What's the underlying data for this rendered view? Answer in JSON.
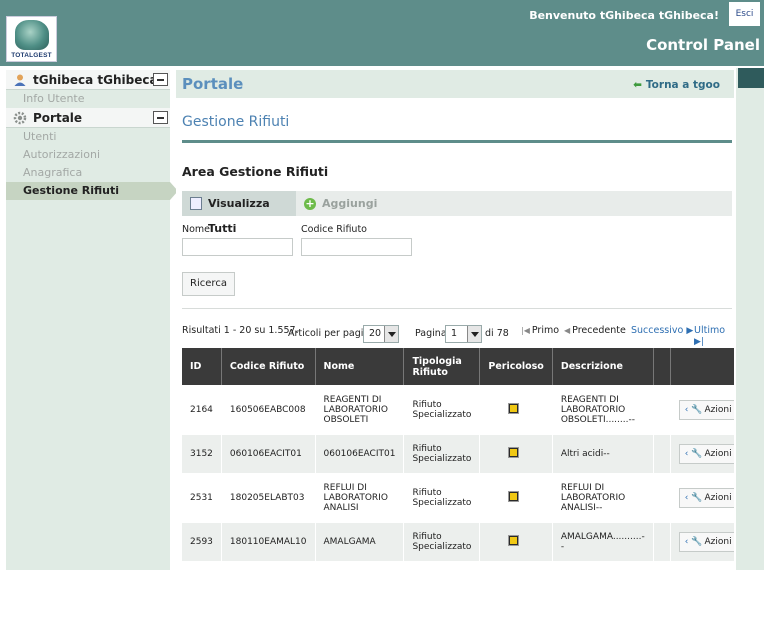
{
  "header": {
    "logo_text": "TOTALGEST",
    "welcome": "Benvenuto tGhibeca tGhibeca!",
    "logout": "Esci",
    "panel_title": "Control Panel"
  },
  "sidebar": {
    "user_section": {
      "title": "tGhibeca tGhibeca",
      "items": [
        {
          "label": "Info Utente"
        }
      ]
    },
    "portal_section": {
      "title": "Portale",
      "items": [
        {
          "label": "Utenti"
        },
        {
          "label": "Autorizzazioni"
        },
        {
          "label": "Anagrafica"
        },
        {
          "label": "Gestione Rifiuti",
          "active": true
        }
      ]
    }
  },
  "main": {
    "portal_title": "Portale",
    "back_link": "Torna a tgoo",
    "section_title": "Gestione Rifiuti",
    "area_title": "Area Gestione Rifiuti",
    "tabs": [
      {
        "label": "Visualizza Tutti"
      },
      {
        "label": "Aggiungi"
      }
    ],
    "filters": {
      "name_label": "Nome",
      "name_value": "",
      "code_label": "Codice Rifiuto",
      "code_value": "",
      "search_button": "Ricerca"
    },
    "pagination": {
      "results": "Risultati 1 - 20 su 1.557.",
      "per_page_label": "Articoli per pagina",
      "per_page_value": "20",
      "page_label": "Pagina",
      "page_value": "1",
      "of_label": "di 78",
      "first": "Primo",
      "prev": "Precedente",
      "next": "Successivo",
      "last": "Ultimo"
    },
    "table": {
      "headers": [
        "ID",
        "Codice Rifiuto",
        "Nome",
        "Tipologia Rifiuto",
        "Pericoloso",
        "Descrizione",
        "",
        ""
      ],
      "rows": [
        {
          "id": "2164",
          "code": "160506EABC008",
          "name": "REAGENTI DI LABORATORIO OBSOLETI",
          "type": "Rifiuto Specializzato",
          "desc": "REAGENTI DI LABORATORIO OBSOLETI........--",
          "action": "Azioni"
        },
        {
          "id": "3152",
          "code": "060106EACIT01",
          "name": "060106EACIT01",
          "type": "Rifiuto Specializzato",
          "desc": "Altri acidi--",
          "action": "Azioni"
        },
        {
          "id": "2531",
          "code": "180205ELABT03",
          "name": "REFLUI DI LABORATORIO ANALISI",
          "type": "Rifiuto Specializzato",
          "desc": "REFLUI DI LABORATORIO ANALISI--",
          "action": "Azioni"
        },
        {
          "id": "2593",
          "code": "180110EAMAL10",
          "name": "AMALGAMA",
          "type": "Rifiuto Specializzato",
          "desc": "AMALGAMA..........--",
          "action": "Azioni"
        }
      ]
    }
  }
}
